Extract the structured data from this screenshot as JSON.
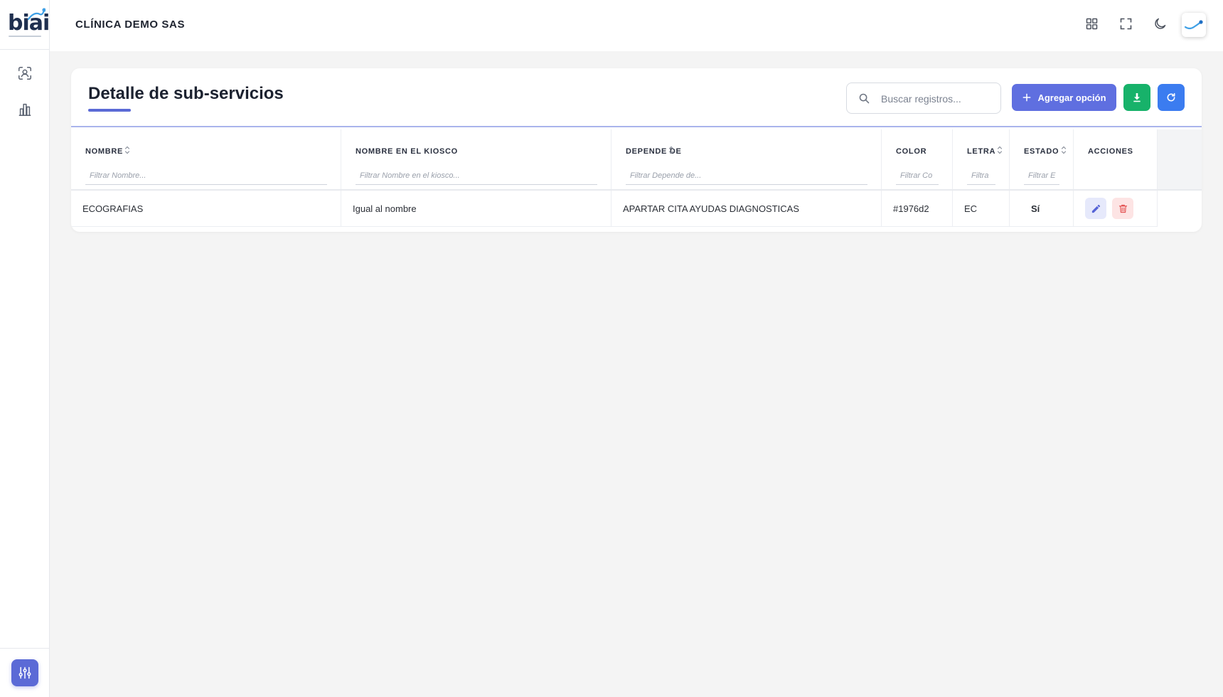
{
  "app": {
    "logo_text": "biai",
    "clinic_name": "CLÍNICA DEMO SAS"
  },
  "sidebar": {
    "items": [
      {
        "icon": "user-scan-icon"
      },
      {
        "icon": "bar-chart-icon"
      }
    ],
    "settings_icon": "sliders-icon"
  },
  "topbar": {
    "icons": [
      "apps-grid-icon",
      "fullscreen-icon",
      "dark-mode-moon-icon"
    ],
    "avatar_icon": "brand-swoosh-icon"
  },
  "page": {
    "title": "Detalle de sub-servicios",
    "search": {
      "placeholder": "Buscar registros..."
    },
    "add_button_label": "Agregar opción",
    "accent_color": "#5f6fe0",
    "download_color": "#17b26a",
    "refresh_color": "#3b7cf0"
  },
  "table": {
    "columns": [
      {
        "label": "NOMBRE",
        "filter_placeholder": "Filtrar Nombre...",
        "sortable": true
      },
      {
        "label": "NOMBRE EN EL KIOSCO",
        "filter_placeholder": "Filtrar Nombre en el kiosco...",
        "sortable": false
      },
      {
        "label": "DEPENDE DE",
        "filter_placeholder": "Filtrar Depende de...",
        "sortable": true
      },
      {
        "label": "COLOR",
        "filter_placeholder": "Filtrar Co",
        "sortable": false
      },
      {
        "label": "LETRA",
        "filter_placeholder": "Filtra",
        "sortable": true
      },
      {
        "label": "ESTADO",
        "filter_placeholder": "Filtrar E",
        "sortable": true
      },
      {
        "label": "ACCIONES",
        "sortable": false
      }
    ],
    "rows": [
      {
        "nombre": "ECOGRAFIAS",
        "nombre_kiosco": "Igual al nombre",
        "depende_de": "APARTAR CITA AYUDAS DIAGNOSTICAS",
        "color": "#1976d2",
        "letra": "EC",
        "estado": "Sí"
      }
    ]
  }
}
